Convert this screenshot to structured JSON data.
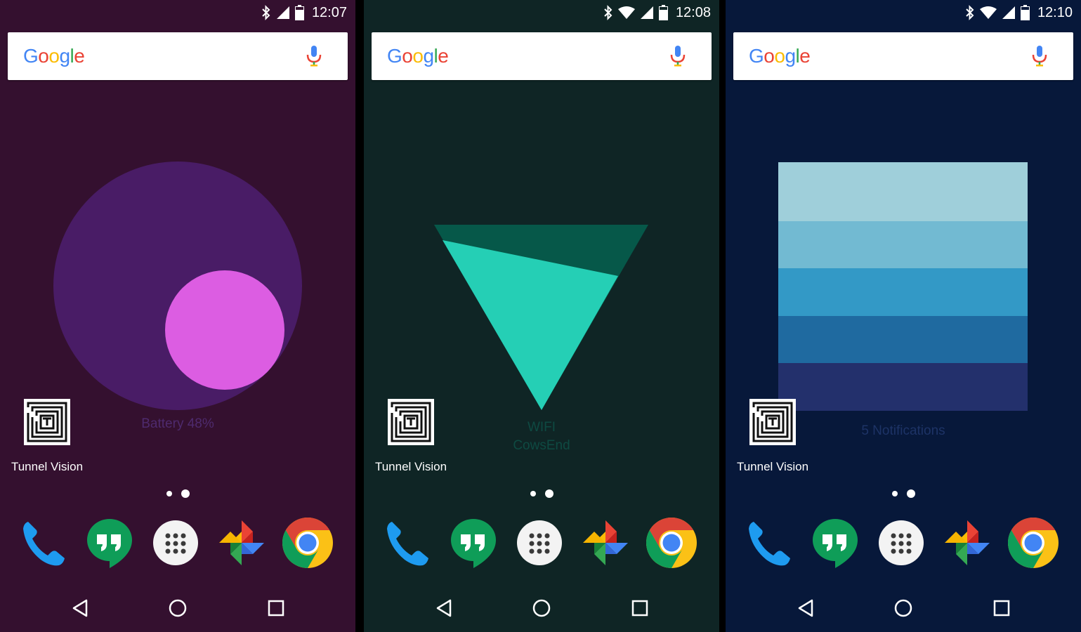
{
  "screens": [
    {
      "id": "battery",
      "time": "12:07",
      "wifi": false,
      "widget_label": "Battery 48%",
      "widget_label_line2": "",
      "app_label": "Tunnel Vision",
      "colors": {
        "background": "#34102f",
        "outer_circle": "#491c66",
        "inner_circle": "#dc5de2",
        "widget_text": "#4e2a6e"
      },
      "battery_level": 0.48
    },
    {
      "id": "wifi",
      "time": "12:08",
      "wifi": true,
      "widget_label": "WIFI",
      "widget_label_line2": "CowsEnd",
      "app_label": "Tunnel Vision",
      "colors": {
        "background": "#0f2525",
        "triangle_dark": "#065849",
        "triangle_light": "#25cfb5",
        "widget_text": "#0e4a42"
      }
    },
    {
      "id": "notifications",
      "time": "12:10",
      "wifi": true,
      "widget_label": "5 Notifications",
      "widget_label_line2": "",
      "app_label": "Tunnel Vision",
      "colors": {
        "background": "#07183a",
        "bands": [
          "#9fcfda",
          "#72bad2",
          "#3399c6",
          "#1f6aa0",
          "#23306c"
        ],
        "widget_text": "#1d3366"
      },
      "notification_count": 5
    }
  ],
  "search": {
    "logo_text": "Google",
    "mic_icon": "mic-icon"
  },
  "page_indicator": {
    "pages": 2,
    "current": 2
  },
  "dock": [
    {
      "app": "Phone",
      "icon": "phone-icon"
    },
    {
      "app": "Hangouts",
      "icon": "hangouts-icon"
    },
    {
      "app": "App drawer",
      "icon": "app-drawer-icon"
    },
    {
      "app": "Photos",
      "icon": "photos-icon"
    },
    {
      "app": "Chrome",
      "icon": "chrome-icon"
    }
  ],
  "nav": [
    "back-icon",
    "home-icon",
    "recents-icon"
  ],
  "brand_colors": {
    "blue": "#4285f4",
    "red": "#ea4335",
    "yellow": "#fbbc05",
    "green": "#34a853"
  }
}
